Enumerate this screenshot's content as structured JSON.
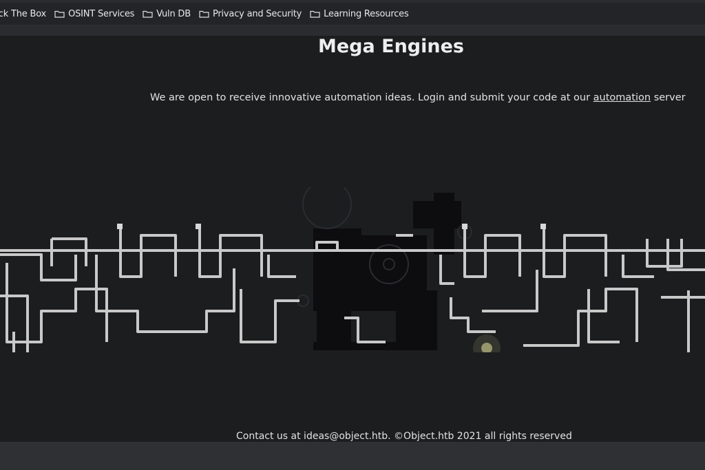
{
  "bookmarks": [
    {
      "label": "ack The Box",
      "icon": "none"
    },
    {
      "label": "OSINT Services",
      "icon": "folder-icon"
    },
    {
      "label": "Vuln DB",
      "icon": "folder-icon"
    },
    {
      "label": "Privacy and Security",
      "icon": "folder-icon"
    },
    {
      "label": "Learning Resources",
      "icon": "folder-icon"
    }
  ],
  "page": {
    "title": "Mega Engines",
    "intro_before": "We are open to receive innovative automation ideas. Login and submit your code at our ",
    "intro_link": "automation",
    "intro_after": " server",
    "footer": "Contact us at ideas@object.htb. ©Object.htb 2021 all rights reserved"
  },
  "colors": {
    "background": "#1c1d1f",
    "pipe": "#c9c9c9",
    "machine": "#0e0e10",
    "bulb": "#e8e4a0"
  }
}
